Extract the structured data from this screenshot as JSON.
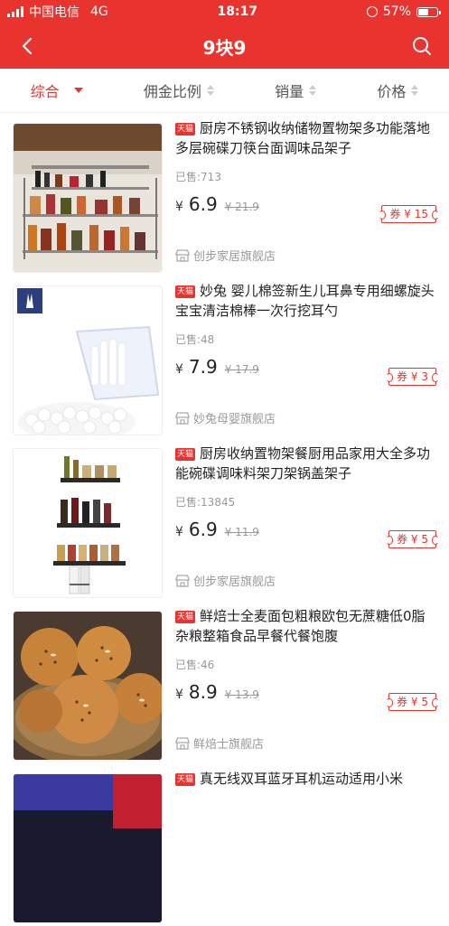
{
  "status": {
    "carrier": "中国电信",
    "network": "4G",
    "time": "18:17",
    "battery": "57%",
    "battery_level": 0.57
  },
  "nav": {
    "title": "9块9"
  },
  "sort": [
    {
      "label": "综合",
      "active": true
    },
    {
      "label": "佣金比例",
      "active": false
    },
    {
      "label": "销量",
      "active": false
    },
    {
      "label": "价格",
      "active": false
    }
  ],
  "items": [
    {
      "badge": "天猫",
      "title": "厨房不锈钢收纳储物置物架多功能落地多层碗碟刀筷台面调味品架子",
      "sold": "已售:713",
      "yen": "¥",
      "price": "6.9",
      "original": "¥ 21.9",
      "coupon": "券 ¥ 15",
      "shop": "创步家居旗舰店"
    },
    {
      "badge": "天猫",
      "title": "妙兔 婴儿棉签新生儿耳鼻专用细螺旋头宝宝清洁棉棒一次行挖耳勺",
      "sold": "已售:48",
      "yen": "¥",
      "price": "7.9",
      "original": "¥ 17.9",
      "coupon": "券 ¥ 3",
      "shop": "妙兔母婴旗舰店"
    },
    {
      "badge": "天猫",
      "title": "厨房收纳置物架餐厨用品家用大全多功能碗碟调味料架刀架锅盖架子",
      "sold": "已售:13845",
      "yen": "¥",
      "price": "6.9",
      "original": "¥ 11.9",
      "coupon": "券 ¥ 5",
      "shop": "创步家居旗舰店"
    },
    {
      "badge": "天猫",
      "title": "鲜焙士全麦面包粗粮欧包无蔗糖低0脂杂粮整箱食品早餐代餐饱腹",
      "sold": "已售:46",
      "yen": "¥",
      "price": "8.9",
      "original": "¥ 13.9",
      "coupon": "券 ¥ 5",
      "shop": "鲜焙士旗舰店"
    },
    {
      "badge": "天猫",
      "title": "真无线双耳蓝牙耳机运动适用小米",
      "sold": "",
      "yen": "",
      "price": "",
      "original": "",
      "coupon": "",
      "shop": ""
    }
  ]
}
